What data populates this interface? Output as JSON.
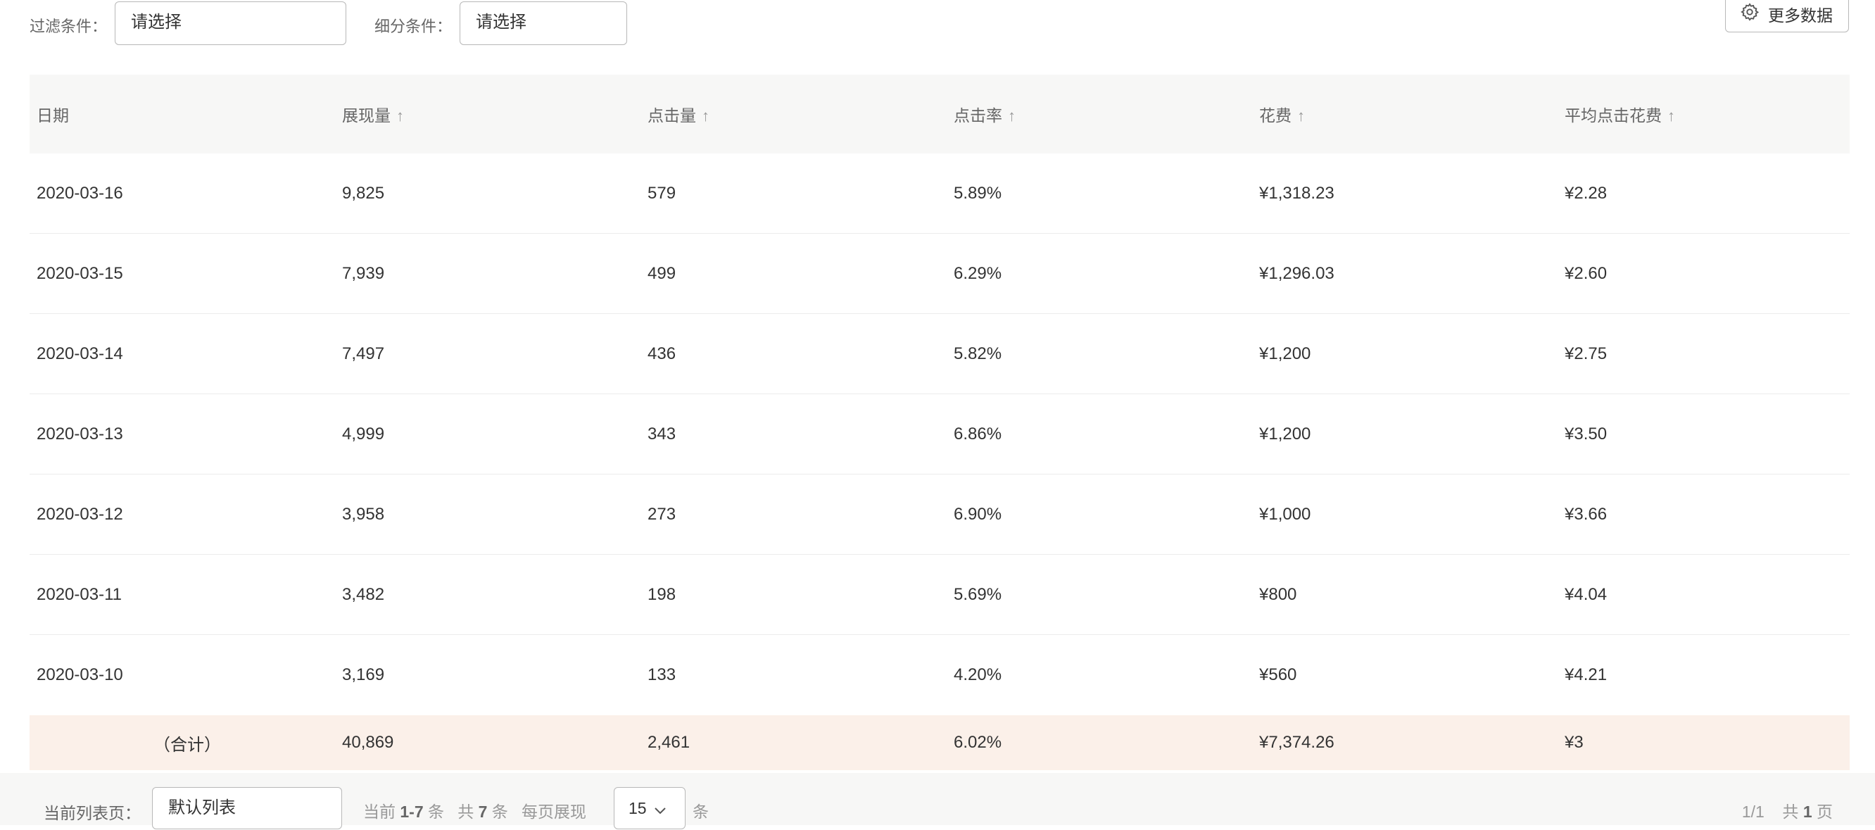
{
  "filters": {
    "filter_label": "过滤条件：",
    "filter_value": "请选择",
    "segment_label": "细分条件：",
    "segment_value": "请选择",
    "more_button": "更多数据"
  },
  "table": {
    "columns": [
      "日期",
      "展现量",
      "点击量",
      "点击率",
      "花费",
      "平均点击花费"
    ],
    "sort_arrow": "↑",
    "rows": [
      [
        "2020-03-16",
        "9,825",
        "579",
        "5.89%",
        "¥1,318.23",
        "¥2.28"
      ],
      [
        "2020-03-15",
        "7,939",
        "499",
        "6.29%",
        "¥1,296.03",
        "¥2.60"
      ],
      [
        "2020-03-14",
        "7,497",
        "436",
        "5.82%",
        "¥1,200",
        "¥2.75"
      ],
      [
        "2020-03-13",
        "4,999",
        "343",
        "6.86%",
        "¥1,200",
        "¥3.50"
      ],
      [
        "2020-03-12",
        "3,958",
        "273",
        "6.90%",
        "¥1,000",
        "¥3.66"
      ],
      [
        "2020-03-11",
        "3,482",
        "198",
        "5.69%",
        "¥800",
        "¥4.04"
      ],
      [
        "2020-03-10",
        "3,169",
        "133",
        "4.20%",
        "¥560",
        "¥4.21"
      ]
    ],
    "total": [
      "（合计）",
      "40,869",
      "2,461",
      "6.02%",
      "¥7,374.26",
      "¥3"
    ]
  },
  "footer": {
    "list_label": "当前列表页：",
    "list_value": "默认列表",
    "current_prefix": "当前",
    "current_range": "1-7",
    "current_suffix": "条",
    "total_prefix": "共",
    "total_count": "7",
    "total_suffix": "条",
    "per_page_label": "每页展现",
    "per_page_value": "15",
    "per_page_unit": "条",
    "page_indicator": "1/1",
    "pages_prefix": "共",
    "pages_count": "1",
    "pages_suffix": "页"
  },
  "icons": {
    "more": "gear-icon",
    "dropdown": "chevron-down-icon",
    "sort": "arrow-up-icon"
  }
}
